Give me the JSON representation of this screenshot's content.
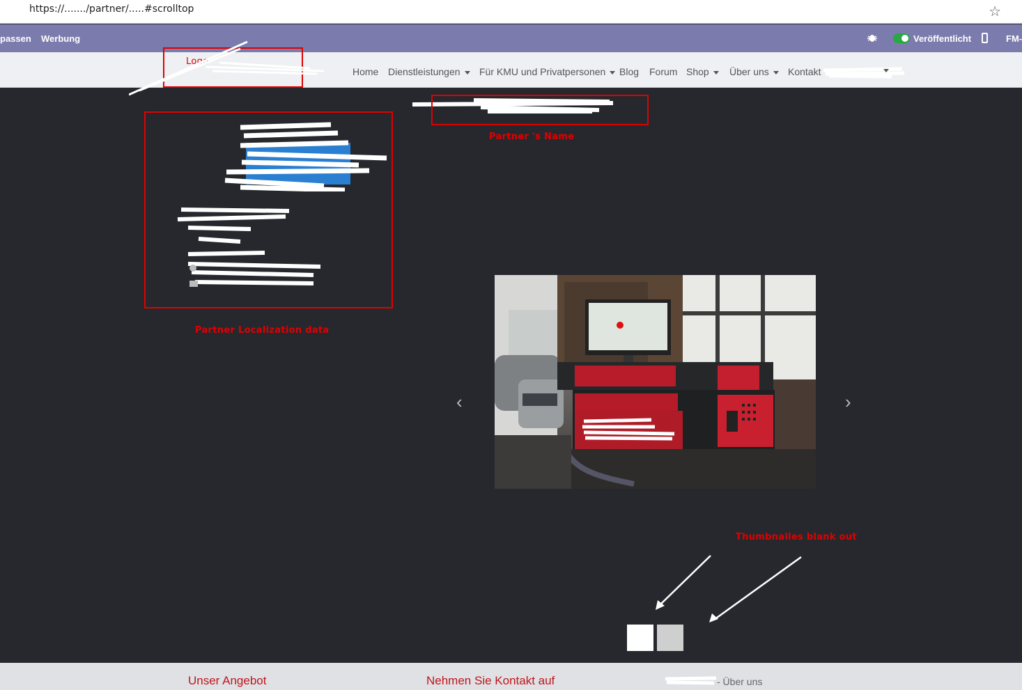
{
  "browser": {
    "url": "https://......./partner/.....#scrolltop"
  },
  "editbar": {
    "left_items": [
      "passen",
      "Werbung"
    ],
    "publish_label": "Veröffentlicht",
    "right_label": "FM-"
  },
  "nav": {
    "items": [
      {
        "label": "Home",
        "dropdown": false
      },
      {
        "label": "Dienstleistungen",
        "dropdown": true
      },
      {
        "label": "Für KMU und Privatpersonen",
        "dropdown": true
      },
      {
        "label": "Blog",
        "dropdown": false
      },
      {
        "label": "Forum",
        "dropdown": false
      },
      {
        "label": "Shop",
        "dropdown": true
      },
      {
        "label": "Über uns",
        "dropdown": true
      },
      {
        "label": "Kontakt",
        "dropdown": false
      }
    ]
  },
  "annotations": {
    "logo": "Logo",
    "partner_name": "Partner 's Name",
    "localization": "Partner Localization data",
    "thumbnails": "Thumbnailes blank out"
  },
  "footer": {
    "col1": "Unser Angebot",
    "col2": "Nehmen Sie Kontakt auf",
    "col3": "- Über uns"
  },
  "colors": {
    "annotation": "#e00000",
    "editbar": "#7c7bad",
    "page_bg": "#26282d",
    "footer_heading": "#c0151b"
  }
}
